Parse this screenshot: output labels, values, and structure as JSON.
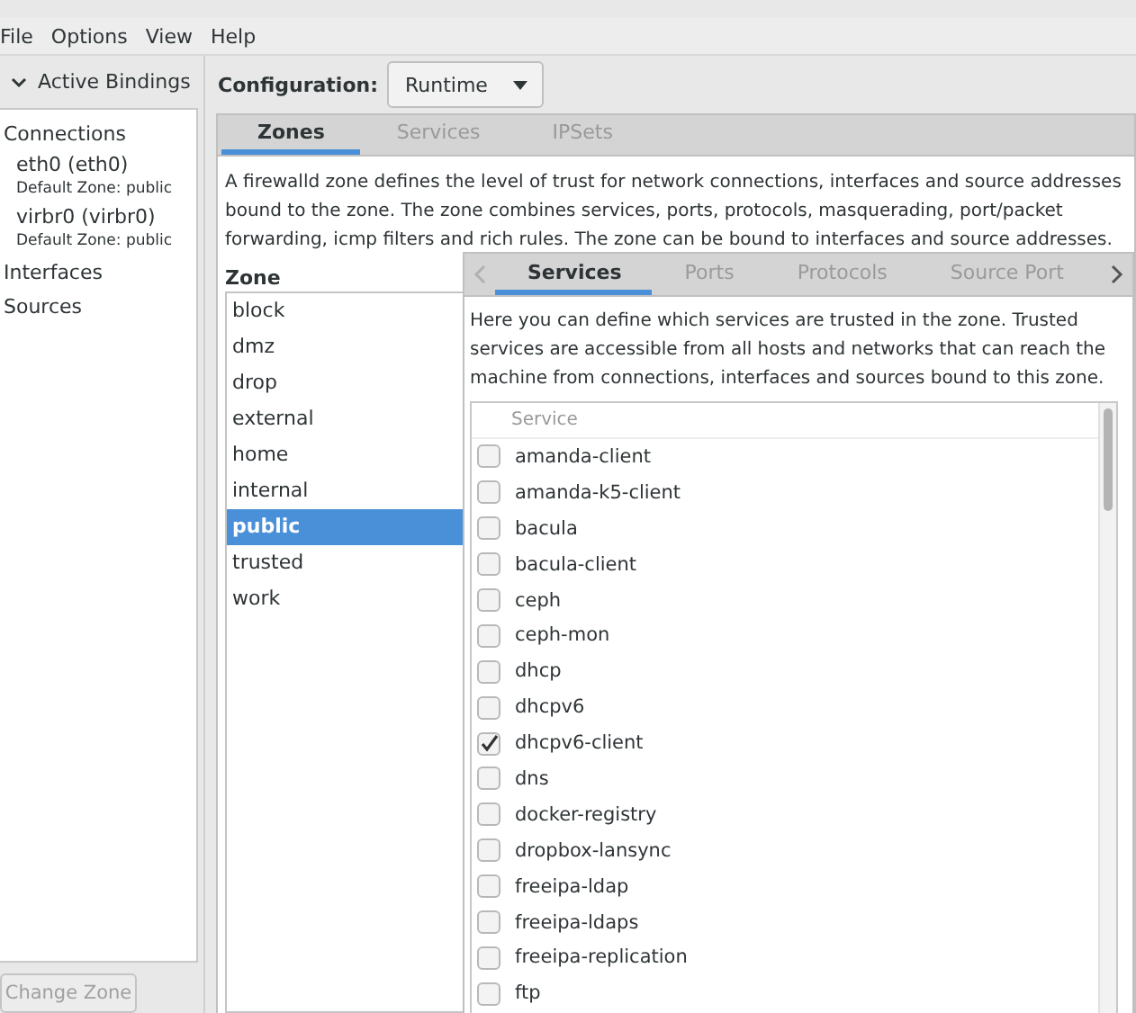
{
  "menu": [
    "File",
    "Options",
    "View",
    "Help"
  ],
  "bindings": {
    "header": "Active Bindings",
    "expanded": true,
    "items": [
      {
        "kind": "section",
        "label": "Connections"
      },
      {
        "kind": "connection",
        "label": "eth0 (eth0)",
        "detail": "Default Zone: public"
      },
      {
        "kind": "connection",
        "label": "virbr0 (virbr0)",
        "detail": "Default Zone: public"
      },
      {
        "kind": "section",
        "label": "Interfaces"
      },
      {
        "kind": "section",
        "label": "Sources"
      }
    ]
  },
  "change_zone_button": {
    "label": "Change Zone",
    "disabled": true
  },
  "configuration": {
    "label": "Configuration:",
    "value": "Runtime"
  },
  "tabs": [
    {
      "label": "Zones",
      "selected": true
    },
    {
      "label": "Services",
      "selected": false
    },
    {
      "label": "IPSets",
      "selected": false
    }
  ],
  "description": "A firewalld zone defines the level of trust for network connections, interfaces and source addresses bound to the zone. The zone combines services, ports, protocols, masquerading, port/packet forwarding, icmp filters and rich rules. The zone can be bound to interfaces and source addresses.",
  "zone_list": {
    "heading": "Zone",
    "items": [
      {
        "label": "block",
        "selected": false
      },
      {
        "label": "dmz",
        "selected": false
      },
      {
        "label": "drop",
        "selected": false
      },
      {
        "label": "external",
        "selected": false
      },
      {
        "label": "home",
        "selected": false
      },
      {
        "label": "internal",
        "selected": false
      },
      {
        "label": "public",
        "selected": true
      },
      {
        "label": "trusted",
        "selected": false
      },
      {
        "label": "work",
        "selected": false
      }
    ]
  },
  "inner_tabs": [
    {
      "label": "Services",
      "selected": true
    },
    {
      "label": "Ports",
      "selected": false
    },
    {
      "label": "Protocols",
      "selected": false
    },
    {
      "label": "Source Port",
      "selected": false
    }
  ],
  "inner_description": "Here you can define which services are trusted in the zone. Trusted services are accessible from all hosts and networks that can reach the machine from connections, interfaces and sources bound to this zone.",
  "services": {
    "column": "Service",
    "rows": [
      {
        "name": "amanda-client",
        "checked": false
      },
      {
        "name": "amanda-k5-client",
        "checked": false
      },
      {
        "name": "bacula",
        "checked": false
      },
      {
        "name": "bacula-client",
        "checked": false
      },
      {
        "name": "ceph",
        "checked": false
      },
      {
        "name": "ceph-mon",
        "checked": false
      },
      {
        "name": "dhcp",
        "checked": false
      },
      {
        "name": "dhcpv6",
        "checked": false
      },
      {
        "name": "dhcpv6-client",
        "checked": true
      },
      {
        "name": "dns",
        "checked": false
      },
      {
        "name": "docker-registry",
        "checked": false
      },
      {
        "name": "dropbox-lansync",
        "checked": false
      },
      {
        "name": "freeipa-ldap",
        "checked": false
      },
      {
        "name": "freeipa-ldaps",
        "checked": false
      },
      {
        "name": "freeipa-replication",
        "checked": false
      },
      {
        "name": "ftp",
        "checked": false
      }
    ]
  }
}
